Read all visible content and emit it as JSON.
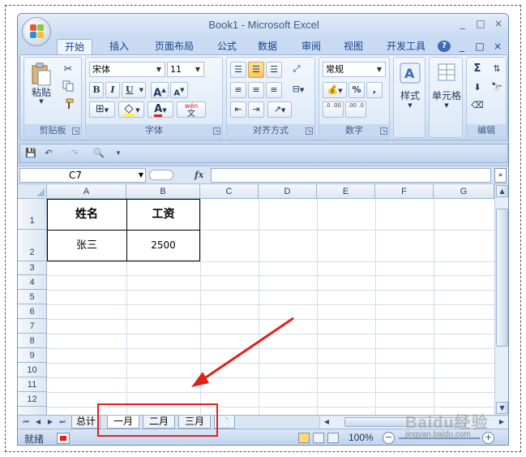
{
  "window": {
    "title": "Book1 - Microsoft Excel",
    "minimize": "_",
    "maximize": "□",
    "close": "×"
  },
  "tabs": [
    "开始",
    "插入",
    "页面布局",
    "公式",
    "数据",
    "审阅",
    "视图",
    "开发工具"
  ],
  "ribbon_ctrl": {
    "help": "?",
    "minimize": "_",
    "restore": "□",
    "close": "×"
  },
  "ribbon": {
    "clipboard": {
      "paste_label": "粘贴",
      "group_label": "剪贴板"
    },
    "font": {
      "font_name": "宋体",
      "font_size": "11",
      "bold": "B",
      "italic": "I",
      "underline": "U",
      "grow": "A",
      "shrink": "A",
      "font_color": "A",
      "wen": "wén",
      "wen_char": "文",
      "group_label": "字体"
    },
    "alignment": {
      "group_label": "对齐方式"
    },
    "number": {
      "format": "常规",
      "percent": "%",
      "comma": ",",
      "inc_dec": ".0 .00",
      "dec_dec": ".00 .0",
      "group_label": "数字"
    },
    "styles": {
      "label": "样式"
    },
    "cells": {
      "label": "单元格"
    },
    "editing": {
      "sum": "Σ",
      "group_label": "编辑"
    }
  },
  "formula_bar": {
    "name_box": "C7",
    "fx": "fx",
    "expand": "»"
  },
  "grid": {
    "columns": [
      "A",
      "B",
      "C",
      "D",
      "E",
      "F",
      "G"
    ],
    "rows": [
      "1",
      "2",
      "3",
      "4",
      "5",
      "6",
      "7",
      "8",
      "9",
      "10",
      "11",
      "12"
    ],
    "cells": {
      "A1": "姓名",
      "B1": "工资",
      "A2": "张三",
      "B2": "2500"
    }
  },
  "sheets": [
    "总计",
    "一月",
    "二月",
    "三月"
  ],
  "status": {
    "ready": "就绪",
    "zoom": "100%"
  },
  "watermark": {
    "brand": "Baidu经验",
    "url": "jingyan.baidu.com"
  },
  "colors": {
    "annotation": "#e0201c",
    "accent": "#15428b"
  }
}
